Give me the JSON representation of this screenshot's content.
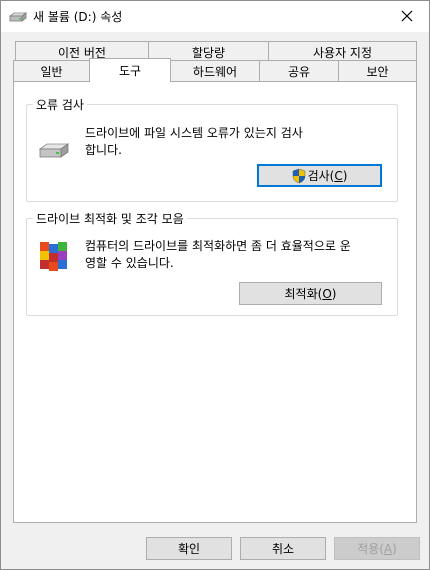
{
  "window": {
    "title": "새 볼륨 (D:) 속성",
    "close_glyph": "✕"
  },
  "tabs": {
    "row1": [
      {
        "label": "이전 버전"
      },
      {
        "label": "할당량"
      },
      {
        "label": "사용자 지정"
      }
    ],
    "row2": [
      {
        "label": "일반"
      },
      {
        "label": "도구",
        "active": true
      },
      {
        "label": "하드웨어"
      },
      {
        "label": "공유"
      },
      {
        "label": "보안"
      }
    ]
  },
  "error_check": {
    "title": "오류 검사",
    "description_line1": "드라이브에 파일 시스템 오류가 있는지 검사",
    "description_line2": "합니다.",
    "button_label": "검사(",
    "button_accel": "C",
    "button_close": ")",
    "icon": "drive-icon"
  },
  "optimize": {
    "title": "드라이브 최적화 및 조각 모음",
    "description_line1": "컴퓨터의 드라이브를 최적화하면 좀 더 효율적으로 운",
    "description_line2": "영할 수 있습니다.",
    "button_label": "최적화(",
    "button_accel": "O",
    "button_close": ")",
    "icon": "defrag-icon"
  },
  "footer": {
    "ok_label": "확인",
    "cancel_label": "취소",
    "apply_label": "적용(",
    "apply_accel": "A",
    "apply_close": ")"
  },
  "colors": {
    "focus_border": "#0078d7",
    "shield_blue": "#1f5fb4",
    "shield_yellow": "#f2c200"
  }
}
